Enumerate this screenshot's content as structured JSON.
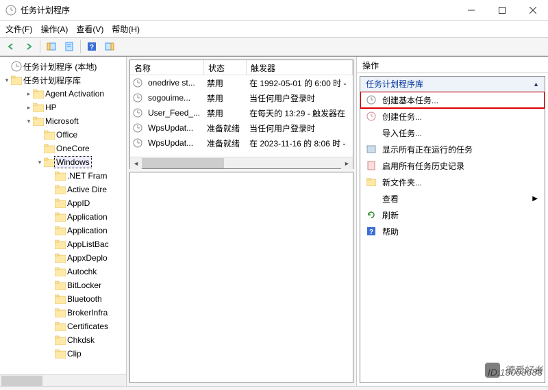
{
  "window": {
    "title": "任务计划程序"
  },
  "menu": {
    "file": "文件(F)",
    "action": "操作(A)",
    "view": "查看(V)",
    "help": "帮助(H)"
  },
  "tree": {
    "root": "任务计划程序 (本地)",
    "library": "任务计划程序库",
    "items": [
      "Agent Activation",
      "HP",
      "Microsoft",
      "Office",
      "OneCore",
      "Windows",
      ".NET Fram",
      "Active Dire",
      "AppID",
      "Application",
      "Application",
      "AppListBac",
      "AppxDeplo",
      "Autochk",
      "BitLocker",
      "Bluetooth",
      "BrokerInfra",
      "Certificates",
      "Chkdsk",
      "Clip"
    ]
  },
  "list": {
    "cols": {
      "name": "名称",
      "status": "状态",
      "trigger": "触发器"
    },
    "rows": [
      {
        "name": "onedrive st...",
        "status": "禁用",
        "trigger": "在 1992-05-01 的 6:00 时 -"
      },
      {
        "name": "sogouime...",
        "status": "禁用",
        "trigger": "当任何用户登录时"
      },
      {
        "name": "User_Feed_...",
        "status": "禁用",
        "trigger": "在每天的 13:29 - 触发器在"
      },
      {
        "name": "WpsUpdat...",
        "status": "准备就绪",
        "trigger": "当任何用户登录时"
      },
      {
        "name": "WpsUpdat...",
        "status": "准备就绪",
        "trigger": "在 2023-11-16 的 8:06 时 -"
      }
    ]
  },
  "actions": {
    "header": "操作",
    "group": "任务计划程序库",
    "create_basic": "创建基本任务...",
    "create_task": "创建任务...",
    "import": "导入任务...",
    "show_running": "显示所有正在运行的任务",
    "enable_history": "启用所有任务历史记录",
    "new_folder": "新文件夹...",
    "view": "查看",
    "refresh": "刷新",
    "help": "帮助"
  },
  "watermark": {
    "text": "德爱好者",
    "id": "ID:13008688"
  }
}
